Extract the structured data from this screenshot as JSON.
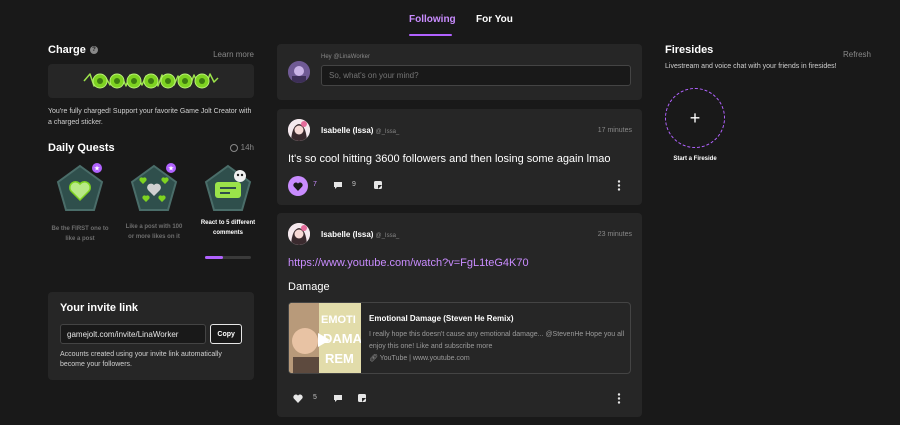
{
  "tabs": [
    {
      "label": "Following",
      "active": true
    },
    {
      "label": "For You",
      "active": false
    }
  ],
  "charge": {
    "title": "Charge",
    "learn_more": "Learn more",
    "message": "You're fully charged! Support your favorite Game Jolt Creator with a charged sticker."
  },
  "quests": {
    "title": "Daily Quests",
    "time_left": "14h",
    "items": [
      {
        "label": "Be the FIRST one to like a post",
        "icon": "heart-badge-icon",
        "new": true,
        "progress": null
      },
      {
        "label": "Like a post with 100 or more likes on it",
        "icon": "hearts-badge-icon",
        "new": true,
        "progress": null
      },
      {
        "label": "React to 5 different comments",
        "icon": "sticker-badge-icon",
        "new": false,
        "progress": 0.4
      }
    ]
  },
  "invite": {
    "title": "Your invite link",
    "link": "gamejolt.com/invite/LinaWorker",
    "copy_label": "Copy",
    "description": "Accounts created using your invite link automatically become your followers."
  },
  "composer": {
    "greeting": "Hey @LinaWorker",
    "placeholder": "So, what's on your mind?"
  },
  "posts": [
    {
      "author": "Isabelle (Issa)",
      "handle": "@_Issa_",
      "time": "17 minutes",
      "text": "It's so cool hitting 3600 followers and then losing some again lmao",
      "likes": "7",
      "liked": true,
      "comments": "9"
    },
    {
      "author": "Isabelle (Issa)",
      "handle": "@_Issa_",
      "time": "23 minutes",
      "link": "https://www.youtube.com/watch?v=FgL1teG4K70",
      "text": "Damage",
      "likes": "5",
      "liked": false,
      "embed": {
        "title": "Emotional Damage (Steven He Remix)",
        "description": "I really hope this doesn't cause any emotional damage... @StevenHe Hope you all enjoy this one! Like and subscribe more",
        "source": "YouTube | www.youtube.com",
        "thumb_text_1": "EMOTI",
        "thumb_text_2": "DAMA",
        "thumb_text_3": "REM"
      }
    }
  ],
  "firesides": {
    "title": "Firesides",
    "refresh": "Refresh",
    "description": "Livestream and voice chat with your friends in firesides!",
    "start_label": "Start a Fireside"
  },
  "colors": {
    "accent": "#b162ff",
    "accent_light": "#c98cff",
    "charge_green": "#7ed321",
    "background": "#191919",
    "card": "#262626"
  }
}
